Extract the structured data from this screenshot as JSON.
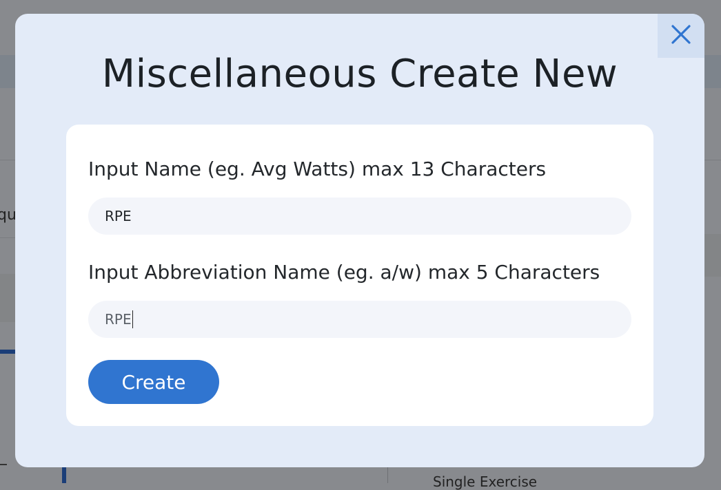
{
  "modal": {
    "title": "Miscellaneous Create New",
    "close_icon": "close-icon",
    "fields": {
      "name": {
        "label": "Input Name (eg. Avg Watts) max 13 Characters",
        "value": "RPE"
      },
      "abbreviation": {
        "label": "Input Abbreviation Name (eg. a/w) max 5 Characters",
        "value": "RPE"
      }
    },
    "create_label": "Create"
  },
  "background": {
    "left_text": "qu",
    "bottom_text": "Single Exercise"
  },
  "colors": {
    "modal_bg": "#e3ebf8",
    "card_bg": "#ffffff",
    "accent": "#3075d0",
    "close_x": "#3075d0"
  }
}
